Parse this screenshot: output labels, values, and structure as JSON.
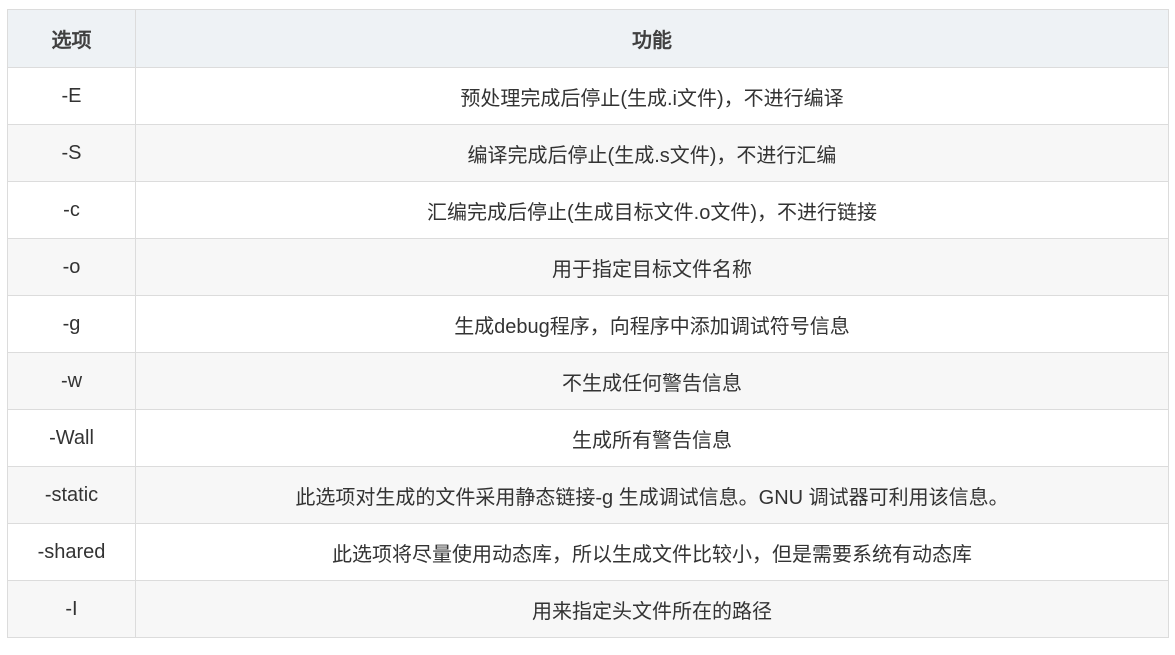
{
  "table": {
    "headers": [
      "选项",
      "功能"
    ],
    "rows": [
      {
        "option": "-E",
        "desc": "预处理完成后停止(生成.i文件)，不进行编译"
      },
      {
        "option": "-S",
        "desc": "编译完成后停止(生成.s文件)，不进行汇编"
      },
      {
        "option": "-c",
        "desc": "汇编完成后停止(生成目标文件.o文件)，不进行链接"
      },
      {
        "option": "-o",
        "desc": "用于指定目标文件名称"
      },
      {
        "option": "-g",
        "desc": "生成debug程序，向程序中添加调试符号信息"
      },
      {
        "option": "-w",
        "desc": "不生成任何警告信息"
      },
      {
        "option": "-Wall",
        "desc": "生成所有警告信息"
      },
      {
        "option": "-static",
        "desc": "此选项对生成的文件采用静态链接-g 生成调试信息。GNU 调试器可利用该信息。"
      },
      {
        "option": "-shared",
        "desc": "此选项将尽量使用动态库，所以生成文件比较小，但是需要系统有动态库"
      },
      {
        "option": "-I",
        "desc": "用来指定头文件所在的路径"
      }
    ]
  }
}
